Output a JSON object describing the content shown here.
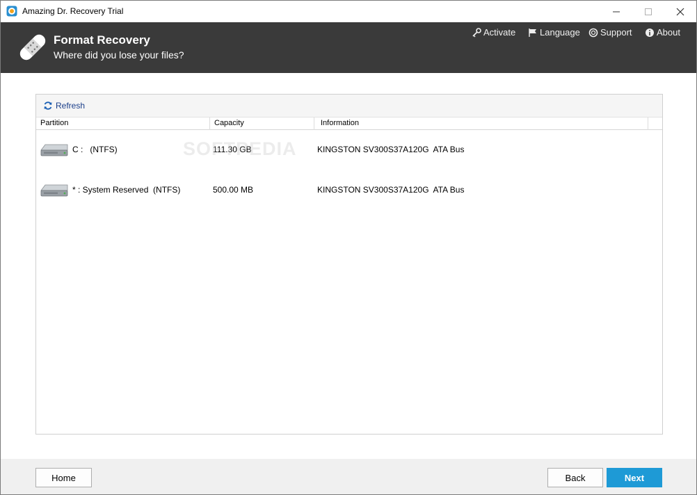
{
  "window": {
    "title": "Amazing Dr. Recovery Trial"
  },
  "header": {
    "title": "Format Recovery",
    "subtitle": "Where did you lose your files?",
    "nav": [
      {
        "label": "Activate",
        "icon": "key-icon"
      },
      {
        "label": "Language",
        "icon": "flag-icon"
      },
      {
        "label": "Support",
        "icon": "lifebuoy-icon"
      },
      {
        "label": "About",
        "icon": "info-icon"
      }
    ]
  },
  "toolbar": {
    "refresh_label": "Refresh"
  },
  "table": {
    "columns": [
      "Partition",
      "Capacity",
      "Information"
    ],
    "rows": [
      {
        "partition": "C :   (NTFS)",
        "capacity": "111.30 GB",
        "information": "KINGSTON SV300S37A120G  ATA Bus"
      },
      {
        "partition": "* : System Reserved  (NTFS)",
        "capacity": "500.00 MB",
        "information": "KINGSTON SV300S37A120G  ATA Bus"
      }
    ]
  },
  "watermark": "SOFTPEDIA",
  "footer": {
    "home_label": "Home",
    "back_label": "Back",
    "next_label": "Next"
  },
  "colors": {
    "header_bg": "#3a3a3a",
    "accent": "#1e9ad6",
    "link": "#1a3e8a"
  }
}
